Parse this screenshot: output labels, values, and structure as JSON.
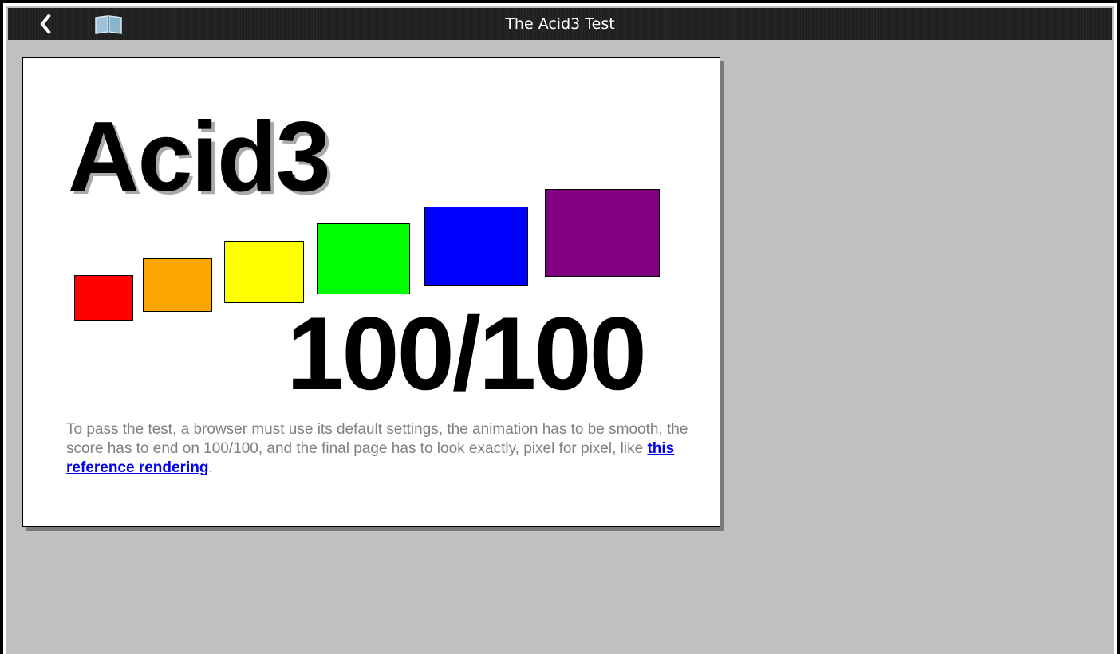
{
  "window": {
    "title": "The Acid3 Test",
    "back_icon": "chevron-left-icon",
    "bookmarks_icon": "book-icon"
  },
  "page": {
    "heading": "Acid3",
    "score": "100/100",
    "description": {
      "before_link": "To pass the test, a browser must use its default settings, the animation has to be smooth, the score has to end on 100/100, and the final page has to look exactly, pixel for pixel, like ",
      "link_text": "this reference rendering",
      "after_link": "."
    },
    "buckets": [
      {
        "name": "bucket-1",
        "color": "#ff0000"
      },
      {
        "name": "bucket-2",
        "color": "#ffa500"
      },
      {
        "name": "bucket-3",
        "color": "#ffff00"
      },
      {
        "name": "bucket-4",
        "color": "#00ff00"
      },
      {
        "name": "bucket-5",
        "color": "#0000ff"
      },
      {
        "name": "bucket-6",
        "color": "#800080"
      }
    ]
  },
  "colors": {
    "viewport_bg": "#c0c0c0",
    "topbar_bg": "#1f1f1f",
    "link": "#0000ee",
    "text_gray": "#808080"
  }
}
